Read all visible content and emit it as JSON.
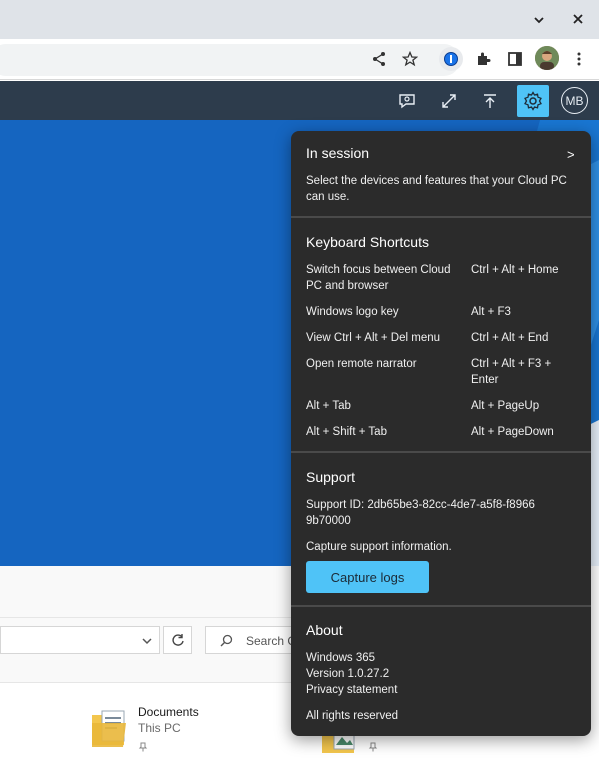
{
  "browser": {
    "icons": [
      "chevron-down-icon",
      "close-icon",
      "share-icon",
      "star-icon",
      "password-manager-icon",
      "extensions-icon",
      "sidebar-icon",
      "profile-avatar",
      "more-menu-icon"
    ]
  },
  "app_header": {
    "avatar_initials": "MB",
    "icons": [
      "feedback-icon",
      "fullscreen-icon",
      "disconnect-icon",
      "settings-icon"
    ]
  },
  "explorer": {
    "search_placeholder": "Search C",
    "items": [
      {
        "name": "Documents",
        "location": "This PC"
      }
    ]
  },
  "flyout": {
    "in_session": {
      "title": "In session",
      "chevron": ">",
      "description": "Select the devices and features that your Cloud PC can use."
    },
    "keyboard_shortcuts": {
      "title": "Keyboard Shortcuts",
      "rows": [
        {
          "action": "Switch focus between Cloud PC and browser",
          "keys": "Ctrl + Alt + Home"
        },
        {
          "action": "Windows logo key",
          "keys": "Alt + F3"
        },
        {
          "action": "View Ctrl + Alt + Del menu",
          "keys": "Ctrl + Alt + End"
        },
        {
          "action": "Open remote narrator",
          "keys": "Ctrl + Alt + F3 + Enter"
        },
        {
          "action": "Alt + Tab",
          "keys": "Alt + PageUp"
        },
        {
          "action": "Alt + Shift + Tab",
          "keys": "Alt + PageDown"
        }
      ]
    },
    "support": {
      "title": "Support",
      "support_id": "Support ID: 2db65be3-82cc-4de7-a5f8-f89669b70000",
      "capture_text": "Capture support information.",
      "capture_button": "Capture logs"
    },
    "about": {
      "title": "About",
      "product": "Windows 365",
      "version": "Version 1.0.27.2",
      "privacy_link": "Privacy statement",
      "rights": "All rights reserved"
    }
  },
  "colors": {
    "accent": "#4fc3f7",
    "header_bg": "#2d3c4c",
    "flyout_bg": "#2b2b2b",
    "desktop_bg": "#1565c0",
    "link": "#6cb8f6"
  }
}
